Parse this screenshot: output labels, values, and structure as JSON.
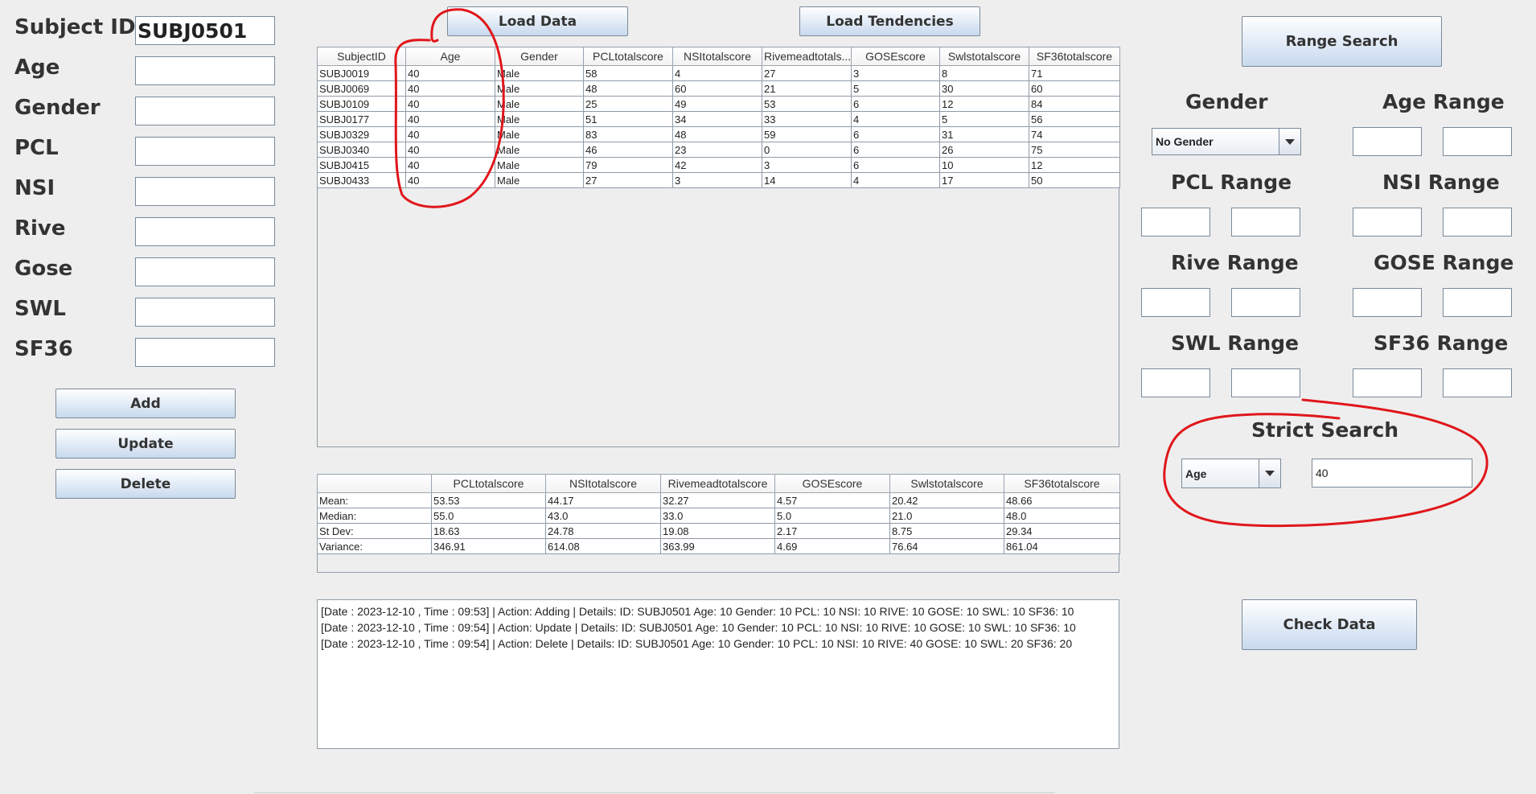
{
  "form": {
    "fields": [
      {
        "label": "Subject ID",
        "value": "SUBJ0501"
      },
      {
        "label": "Age",
        "value": ""
      },
      {
        "label": "Gender",
        "value": ""
      },
      {
        "label": "PCL",
        "value": ""
      },
      {
        "label": "NSI",
        "value": ""
      },
      {
        "label": "Rive",
        "value": ""
      },
      {
        "label": "Gose",
        "value": ""
      },
      {
        "label": "SWL",
        "value": ""
      },
      {
        "label": "SF36",
        "value": ""
      }
    ],
    "add_label": "Add",
    "update_label": "Update",
    "delete_label": "Delete"
  },
  "toolbar": {
    "load_data_label": "Load Data",
    "load_tendencies_label": "Load Tendencies"
  },
  "data_table": {
    "headers": [
      "SubjectID",
      "Age",
      "Gender",
      "PCLtotalscore",
      "NSItotalscore",
      "Rivemeadtotals...",
      "GOSEscore",
      "Swlstotalscore",
      "SF36totalscore"
    ],
    "rows": [
      [
        "SUBJ0019",
        "40",
        "Male",
        "58",
        "4",
        "27",
        "3",
        "8",
        "71"
      ],
      [
        "SUBJ0069",
        "40",
        "Male",
        "48",
        "60",
        "21",
        "5",
        "30",
        "60"
      ],
      [
        "SUBJ0109",
        "40",
        "Male",
        "25",
        "49",
        "53",
        "6",
        "12",
        "84"
      ],
      [
        "SUBJ0177",
        "40",
        "Male",
        "51",
        "34",
        "33",
        "4",
        "5",
        "56"
      ],
      [
        "SUBJ0329",
        "40",
        "Male",
        "83",
        "48",
        "59",
        "6",
        "31",
        "74"
      ],
      [
        "SUBJ0340",
        "40",
        "Male",
        "46",
        "23",
        "0",
        "6",
        "26",
        "75"
      ],
      [
        "SUBJ0415",
        "40",
        "Male",
        "79",
        "42",
        "3",
        "6",
        "10",
        "12"
      ],
      [
        "SUBJ0433",
        "40",
        "Male",
        "27",
        "3",
        "14",
        "4",
        "17",
        "50"
      ]
    ]
  },
  "stats_table": {
    "headers": [
      "",
      "PCLtotalscore",
      "NSItotalscore",
      "Rivemeadtotalscore",
      "GOSEscore",
      "Swlstotalscore",
      "SF36totalscore"
    ],
    "rows": [
      [
        "Mean:",
        "53.53",
        "44.17",
        "32.27",
        "4.57",
        "20.42",
        "48.66"
      ],
      [
        "Median:",
        "55.0",
        "43.0",
        "33.0",
        "5.0",
        "21.0",
        "48.0"
      ],
      [
        "St Dev:",
        "18.63",
        "24.78",
        "19.08",
        "2.17",
        "8.75",
        "29.34"
      ],
      [
        "Variance:",
        "346.91",
        "614.08",
        "363.99",
        "4.69",
        "76.64",
        "861.04"
      ]
    ]
  },
  "log": [
    "[Date : 2023-12-10 , Time : 09:53] | Action: Adding | Details: ID: SUBJ0501 Age: 10 Gender: 10 PCL: 10 NSI: 10 RIVE: 10 GOSE: 10 SWL: 10 SF36: 10",
    "[Date : 2023-12-10 , Time : 09:54] | Action: Update | Details: ID: SUBJ0501 Age: 10 Gender: 10 PCL: 10 NSI: 10 RIVE: 10 GOSE: 10 SWL: 10 SF36: 10",
    "[Date : 2023-12-10 , Time : 09:54] | Action: Delete | Details: ID: SUBJ0501 Age: 10 Gender: 10 PCL: 10 NSI: 10 RIVE: 40 GOSE: 10 SWL: 20 SF36: 20"
  ],
  "search": {
    "range_search_label": "Range Search",
    "gender_label": "Gender",
    "gender_selected": "No Gender",
    "ranges": [
      {
        "label": "Age Range"
      },
      {
        "label": "PCL Range"
      },
      {
        "label": "NSI Range"
      },
      {
        "label": "Rive Range"
      },
      {
        "label": "GOSE Range"
      },
      {
        "label": "SWL Range"
      },
      {
        "label": "SF36 Range"
      }
    ],
    "strict_label": "Strict Search",
    "strict_field": "Age",
    "strict_value": "40",
    "check_data_label": "Check Data"
  },
  "colors": {
    "annotation": "#e0161b",
    "button_gradient_end": "#c8d9ee"
  }
}
